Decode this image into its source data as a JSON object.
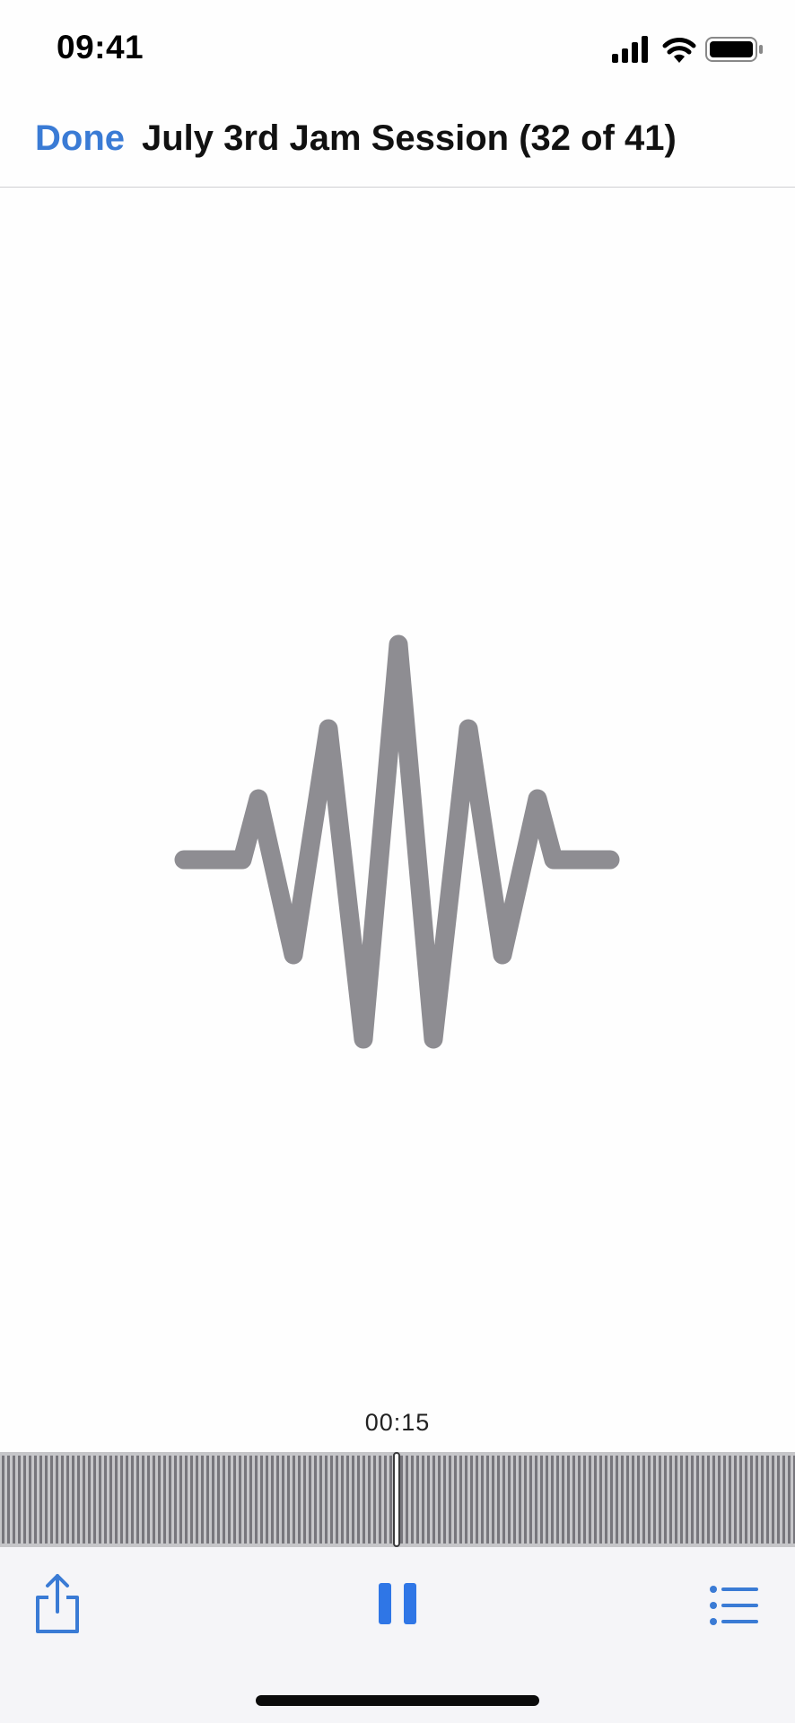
{
  "status_bar": {
    "time": "09:41",
    "icons": [
      "cellular-signal-icon",
      "wifi-icon",
      "battery-icon"
    ]
  },
  "nav": {
    "done_label": "Done",
    "title": "July 3rd Jam Session (32 of 41)"
  },
  "artwork": {
    "icon": "waveform-icon",
    "color": "#8e8d92"
  },
  "playback": {
    "current_time": "00:15"
  },
  "toolbar": {
    "share_icon": "share-icon",
    "pause_icon": "pause-icon",
    "list_icon": "list-icon"
  },
  "colors": {
    "accent": "#3a7bd5",
    "waveform": "#8e8d92",
    "scrubber_bg": "#c6c6c9",
    "toolbar_bg": "#f5f5f8"
  }
}
